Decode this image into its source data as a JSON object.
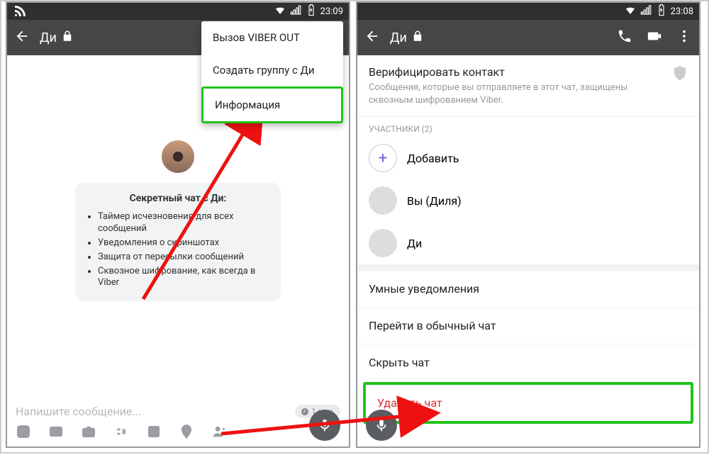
{
  "left": {
    "status_time": "23:09",
    "header_title": "Ди",
    "popup": {
      "items": [
        "Вызов VIBER OUT",
        "Создать группу с Ди",
        "Информация"
      ]
    },
    "card": {
      "title": "Секретный чат с Ди:",
      "bullets": [
        "Таймер исчезновения для всех сообщений",
        "Уведомления о скриншотах",
        "Защита от пересылки сообщений",
        "Сквозное шифрование, как всегда в Viber"
      ]
    },
    "compose_placeholder": "Напишите сообщение...",
    "timer_label": "1 мин."
  },
  "right": {
    "status_time": "23:08",
    "header_title": "Ди",
    "verify_title": "Верифицировать контакт",
    "verify_sub": "Сообщения, которые вы отправляете в этот чат, защищены сквозным шифрованием Viber.",
    "participants_label": "УЧАСТНИКИ (2)",
    "add_label": "Добавить",
    "members": [
      "Вы (Диля)",
      "Ди"
    ],
    "options": {
      "smart_notif": "Умные уведомления",
      "to_regular": "Перейти в обычный чат",
      "hide": "Скрыть чат",
      "delete": "Удалить чат"
    }
  }
}
